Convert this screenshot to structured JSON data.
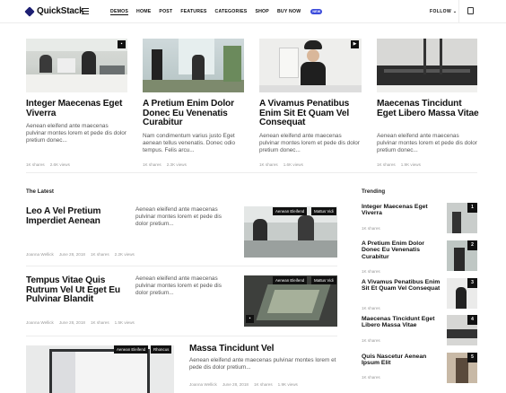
{
  "header": {
    "logo": "QuickStack",
    "nav": [
      "DEMOS",
      "HOME",
      "POST",
      "FEATURES",
      "CATEGORIES",
      "SHOP",
      "BUY NOW"
    ],
    "buy_badge": "NEW",
    "follow": "FOLLOW"
  },
  "top_posts": [
    {
      "title": "Integer Maecenas Eget Viverra",
      "excerpt": "Aenean eleifend ante maecenas pulvinar montes lorem et pede dis dolor pretium donec...",
      "shares": "1K shares",
      "views": "2.6K views"
    },
    {
      "title": "A Pretium Enim Dolor Donec Eu Venenatis Curabitur",
      "excerpt": "Nam condimentum varius justo Eget aenean tellus venenatis. Donec odio tempus. Felis arcu...",
      "shares": "1K shares",
      "views": "2.3K views"
    },
    {
      "title": "A Vivamus Penatibus Enim Sit Et Quam Vel Consequat",
      "excerpt": "Aenean eleifend ante maecenas pulvinar montes lorem et pede dis dolor pretium donec...",
      "shares": "1K shares",
      "views": "1.6K views"
    },
    {
      "title": "Maecenas Tincidunt Eget Libero Massa Vitae",
      "excerpt": "Aenean eleifend ante maecenas pulvinar montes lorem et pede dis dolor pretium donec...",
      "shares": "1K shares",
      "views": "1.9K views"
    }
  ],
  "latest": {
    "heading": "The Latest",
    "posts": [
      {
        "title": "Leo A Vel Pretium Imperdiet Aenean",
        "excerpt": "Aenean eleifend ante maecenas pulvinar montes lorem et pede dis dolor pretium...",
        "author": "Joanna Wellick",
        "date": "June 28, 2018",
        "shares": "1K shares",
        "views": "2.2K views",
        "tags": [
          "Aenean Eleifend",
          "Mattus Vidi"
        ]
      },
      {
        "title": "Tempus Vitae Quis Rutrum Vel Ut Eget Eu Pulvinar Blandit",
        "excerpt": "Aenean eleifend ante maecenas pulvinar montes lorem et pede dis dolor pretium...",
        "author": "Joanna Wellick",
        "date": "June 28, 2018",
        "shares": "1K shares",
        "views": "1.5K views",
        "tags": [
          "Aenean Eleifend",
          "Mattus Vidi"
        ]
      },
      {
        "title": "Massa Tincidunt Vel",
        "excerpt": "Aenean eleifend ante maecenas pulvinar montes lorem et pede dis dolor pretium...",
        "author": "Joanna Wellick",
        "date": "June 28, 2018",
        "shares": "1K shares",
        "views": "1.9K views",
        "tags": [
          "Aenean Eleifend",
          "Rhoncus"
        ]
      }
    ]
  },
  "trending": {
    "heading": "Trending",
    "posts": [
      {
        "title": "Integer Maecenas Eget Viverra",
        "shares": "1K shares",
        "num": "1"
      },
      {
        "title": "A Pretium Enim Dolor Donec Eu Venenatis Curabitur",
        "shares": "1K shares",
        "num": "2"
      },
      {
        "title": "A Vivamus Penatibus Enim Sit Et Quam Vel Consequat",
        "shares": "1K shares",
        "num": "3"
      },
      {
        "title": "Maecenas Tincidunt Eget Libero Massa Vitae",
        "shares": "1K shares",
        "num": "4"
      },
      {
        "title": "Quis Nascetur Aenean Ipsum Elit",
        "shares": "1K shares",
        "num": "5"
      }
    ]
  },
  "colors": {
    "accent": "#3b4bdb",
    "text": "#111111",
    "muted": "#999999"
  }
}
